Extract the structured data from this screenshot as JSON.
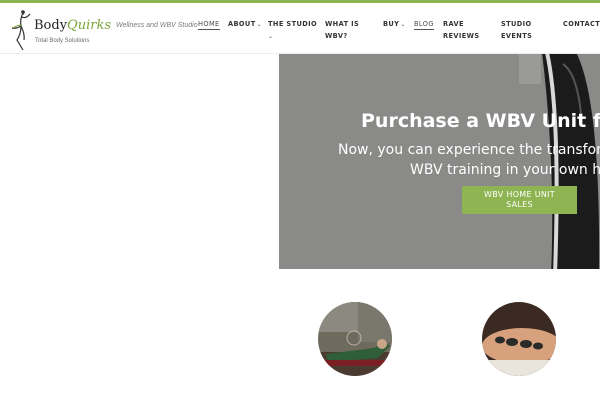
{
  "logo": {
    "brand_prefix": "Body",
    "brand_suffix": "Quirks",
    "tagline": "Total Body Solutions"
  },
  "header": {
    "tagline": "Wellness and WBV Studio"
  },
  "nav": {
    "home": "HOME",
    "about": "ABOUT",
    "studio": "THE STUDIO",
    "what_is_1": "WHAT IS",
    "what_is_2": "WBV?",
    "buy": "BUY",
    "blog": "BLOG",
    "rave_1": "RAVE",
    "rave_2": "REVIEWS",
    "events_1": "STUDIO",
    "events_2": "EVENTS",
    "contact": "CONTACT"
  },
  "hero": {
    "title": "Purchase a WBV Unit fo",
    "subtitle_line1": "Now, you can experience the transform",
    "subtitle_line2": "WBV training in your own ho",
    "button_line1": "WBV HOME UNIT",
    "button_line2": "SALES"
  },
  "colors": {
    "accent": "#8fb552",
    "hero_bg": "#8a8a88"
  },
  "icons": {
    "dropdown": "chevron-down-icon",
    "logo_figure": "dancer-figure-icon"
  }
}
